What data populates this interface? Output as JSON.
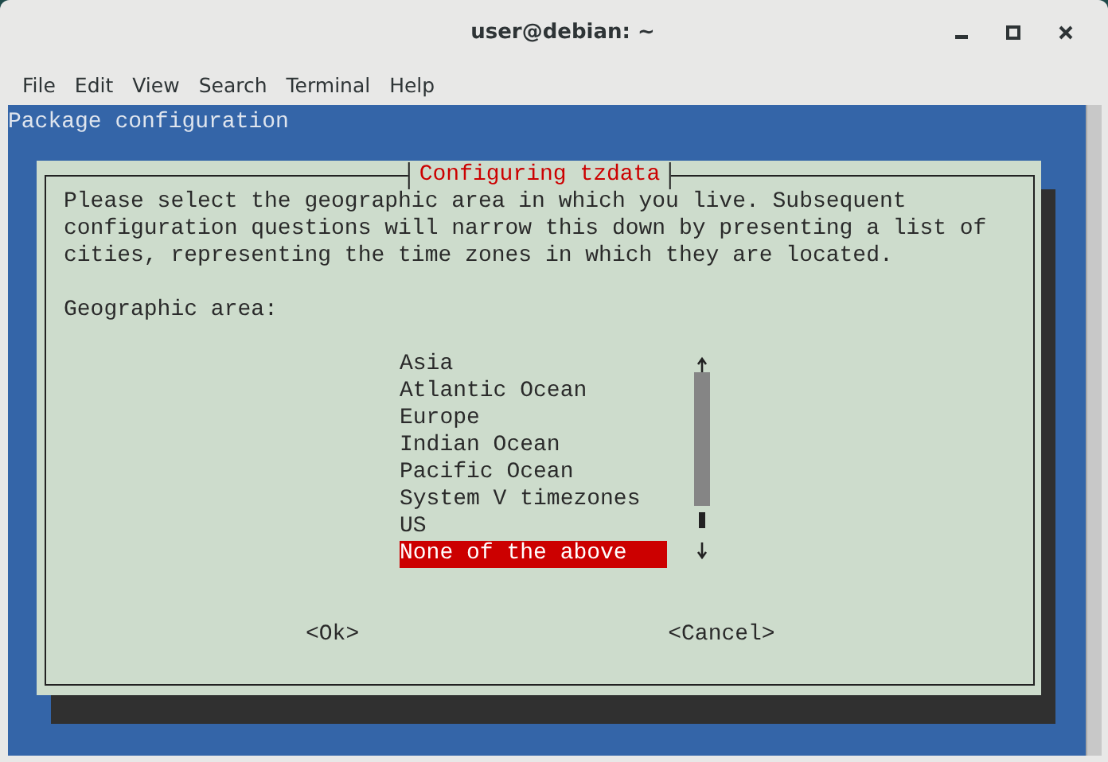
{
  "window": {
    "title": "user@debian: ~"
  },
  "menu": [
    "File",
    "Edit",
    "View",
    "Search",
    "Terminal",
    "Help"
  ],
  "terminal": {
    "header": "Package configuration",
    "dialog": {
      "title": "Configuring tzdata",
      "message": "Please select the geographic area in which you live. Subsequent\nconfiguration questions will narrow this down by presenting a list of\ncities, representing the time zones in which they are located.",
      "prompt": "Geographic area:",
      "items": [
        {
          "label": "Asia",
          "selected": false
        },
        {
          "label": "Atlantic Ocean",
          "selected": false
        },
        {
          "label": "Europe",
          "selected": false
        },
        {
          "label": "Indian Ocean",
          "selected": false
        },
        {
          "label": "Pacific Ocean",
          "selected": false
        },
        {
          "label": "System V timezones",
          "selected": false
        },
        {
          "label": "US",
          "selected": false
        },
        {
          "label": "None of the above",
          "selected": true
        }
      ],
      "buttons": [
        "<Ok>",
        "<Cancel>"
      ]
    }
  }
}
